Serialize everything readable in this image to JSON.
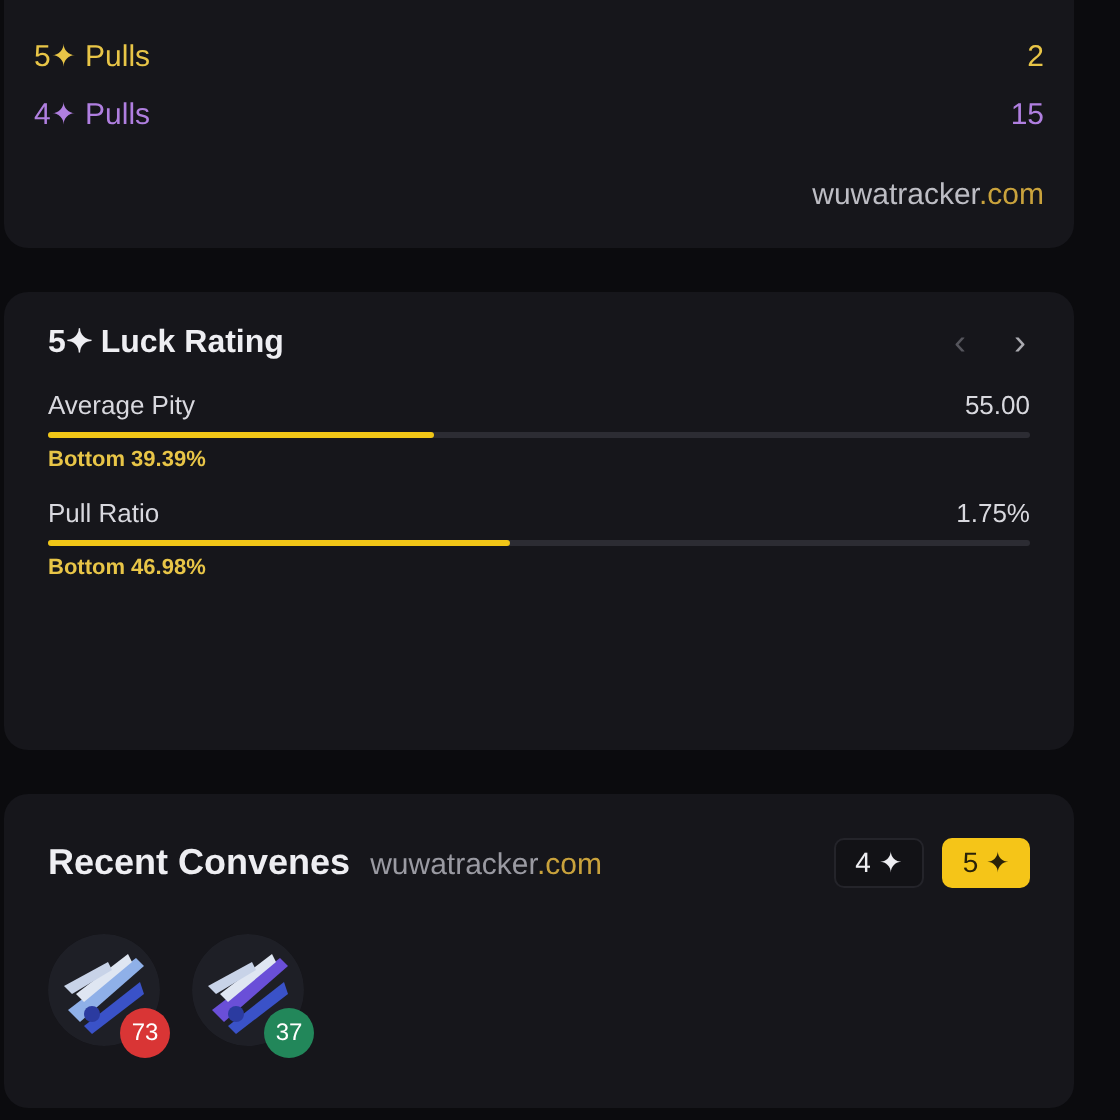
{
  "summary": {
    "rows": [
      {
        "label": "5✦ Pulls",
        "value": "2",
        "color": "#e8c547"
      },
      {
        "label": "4✦ Pulls",
        "value": "15",
        "color": "#b07fe0"
      }
    ],
    "watermark": {
      "name": "wuwatracker",
      "tld": ".com"
    }
  },
  "luck_rating": {
    "title": "5✦ Luck Rating",
    "prev": "‹",
    "next": "›",
    "metrics": [
      {
        "label": "Average Pity",
        "reading": "55.00",
        "level": 0.3939,
        "percentile": "Bottom 39.39%"
      },
      {
        "label": "Pull Ratio",
        "reading": "1.75%",
        "level": 0.4698,
        "percentile": "Bottom 46.98%"
      }
    ]
  },
  "recent_convenes": {
    "title": "Recent Convenes",
    "site": {
      "name": "wuwatracker",
      "tld": ".com"
    },
    "filters": [
      {
        "label": "4 ✦",
        "selected": false
      },
      {
        "label": "5 ✦",
        "selected": true
      }
    ],
    "items": [
      {
        "kind": "picture",
        "pity": "73",
        "color": "#d93535"
      },
      {
        "kind": "picture",
        "pity": "37",
        "color": "#22875a"
      }
    ]
  }
}
